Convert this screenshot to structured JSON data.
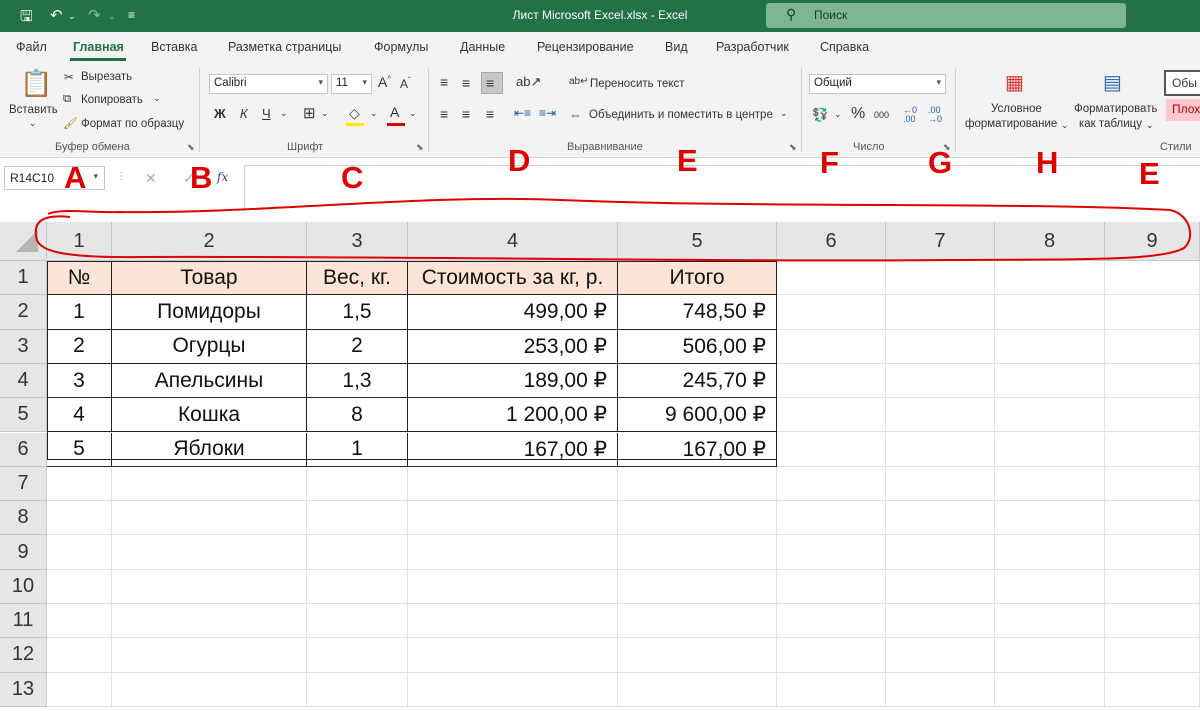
{
  "window": {
    "title": "Лист Microsoft Excel.xlsx  -  Excel",
    "search_placeholder": "Поиск"
  },
  "menu": [
    "Файл",
    "Главная",
    "Вставка",
    "Разметка страницы",
    "Формулы",
    "Данные",
    "Рецензирование",
    "Вид",
    "Разработчик",
    "Справка"
  ],
  "ribbon": {
    "clipboard": {
      "paste": "Вставить",
      "cut": "Вырезать",
      "copy": "Копировать",
      "format_painter": "Формат по образцу",
      "group": "Буфер обмена"
    },
    "font": {
      "name": "Calibri",
      "size": "11",
      "bold": "Ж",
      "italic": "К",
      "underline": "Ч",
      "group": "Шрифт"
    },
    "alignment": {
      "wrap": "Переносить текст",
      "merge": "Объединить и поместить в центре",
      "group": "Выравнивание"
    },
    "number": {
      "format": "Общий",
      "percent": "%",
      "thousands": "000",
      "group": "Число"
    },
    "styles": {
      "conditional_line1": "Условное",
      "conditional_line2": "форматирование",
      "table_line1": "Форматировать",
      "table_line2": "как таблицу",
      "normal": "Обы",
      "bad": "Плох",
      "group": "Стили"
    }
  },
  "formula_bar": {
    "name_box": "R14C10",
    "fx": "fx",
    "cancel": "✕",
    "enter": "✓",
    "value": ""
  },
  "callouts": [
    "A",
    "B",
    "C",
    "D",
    "E",
    "F",
    "G",
    "H",
    "E"
  ],
  "columns": [
    "1",
    "2",
    "3",
    "4",
    "5",
    "6",
    "7",
    "8",
    "9"
  ],
  "rows": [
    "1",
    "2",
    "3",
    "4",
    "5",
    "6",
    "7",
    "8",
    "9",
    "10",
    "11",
    "12",
    "13"
  ],
  "table": {
    "header": [
      "№",
      "Товар",
      "Вес, кг.",
      "Стоимость за кг, р.",
      "Итого"
    ],
    "rows": [
      [
        "1",
        "Помидоры",
        "1,5",
        "499,00 ₽",
        "748,50 ₽"
      ],
      [
        "2",
        "Огурцы",
        "2",
        "253,00 ₽",
        "506,00 ₽"
      ],
      [
        "3",
        "Апельсины",
        "1,3",
        "189,00 ₽",
        "245,70 ₽"
      ],
      [
        "4",
        "Кошка",
        "8",
        "1 200,00 ₽",
        "9 600,00 ₽"
      ],
      [
        "5",
        "Яблоки",
        "1",
        "167,00 ₽",
        "167,00 ₽"
      ]
    ]
  },
  "colors": {
    "excel_green": "#217346",
    "header_fill": "#fce4d6",
    "annotation_red": "#e00000"
  }
}
